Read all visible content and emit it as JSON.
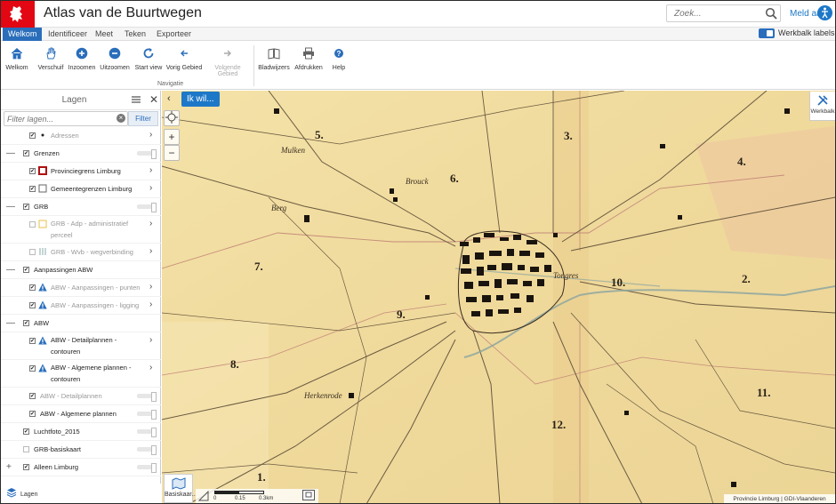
{
  "app": {
    "title": "Atlas van de Buurtwegen"
  },
  "header": {
    "search_placeholder": "Zoek...",
    "login_label": "Meld aan"
  },
  "tabs": [
    {
      "label": "Welkom",
      "active": true
    },
    {
      "label": "Identificeer"
    },
    {
      "label": "Meet"
    },
    {
      "label": "Teken"
    },
    {
      "label": "Exporteer"
    }
  ],
  "werkbalk_labels": "Werkbalk labels",
  "toolbar": {
    "tools": [
      {
        "label": "Welkom",
        "icon": "home-icon"
      },
      {
        "label": "Verschuif",
        "icon": "hand-icon"
      },
      {
        "label": "Inzoomen",
        "icon": "zoom-in-icon"
      },
      {
        "label": "Uitzoomen",
        "icon": "zoom-out-icon"
      },
      {
        "label": "Start view",
        "icon": "refresh-icon"
      },
      {
        "label": "Vorig Gebied",
        "icon": "arrow-left-icon"
      },
      {
        "label": "Volgende Gebied",
        "icon": "arrow-right-icon",
        "disabled": true
      },
      {
        "label": "Bladwijzers",
        "icon": "bookmark-icon"
      },
      {
        "label": "Afdrukken",
        "icon": "printer-icon"
      },
      {
        "label": "Help",
        "icon": "help-icon"
      }
    ],
    "group_label": "Navigatie"
  },
  "panel": {
    "title": "Lagen",
    "filter_placeholder": "Filter lagen...",
    "filter_button": "Filter",
    "footer_label": "Lagen",
    "layers": [
      {
        "label": "Adressen",
        "checked": true,
        "dim": true,
        "legend": "dot",
        "chevron": true
      },
      {
        "label": "Grenzen",
        "checked": true,
        "group": true,
        "expander": "—",
        "slider": true
      },
      {
        "label": "Provinciegrens Limburg",
        "checked": true,
        "legend": "red-square",
        "chevron": true
      },
      {
        "label": "Gemeentegrenzen Limburg",
        "checked": true,
        "legend": "grey-square",
        "chevron": true
      },
      {
        "label": "GRB",
        "checked": true,
        "group": true,
        "expander": "—",
        "slider": true
      },
      {
        "label": "GRB - Adp - administratief perceel",
        "checked": false,
        "dim": true,
        "legend": "yellow-square",
        "chevron": true,
        "tall": true
      },
      {
        "label": "GRB - Wvb - wegverbinding",
        "checked": false,
        "dim": true,
        "legend": "road",
        "chevron": true
      },
      {
        "label": "Aanpassingen ABW",
        "checked": true,
        "group": true,
        "expander": "—"
      },
      {
        "label": "ABW - Aanpassingen - punten",
        "checked": true,
        "dim": true,
        "legend": "warning",
        "chevron": true
      },
      {
        "label": "ABW - Aanpassingen - ligging",
        "checked": true,
        "dim": true,
        "legend": "warning",
        "chevron": true
      },
      {
        "label": "ABW",
        "checked": true,
        "group": true,
        "expander": "—"
      },
      {
        "label": "ABW - Detailplannen - contouren",
        "checked": true,
        "legend": "warning",
        "chevron": true,
        "tall": true
      },
      {
        "label": "ABW - Algemene plannen - contouren",
        "checked": true,
        "legend": "warning",
        "chevron": true,
        "tall": true
      },
      {
        "label": "ABW - Detailplannen",
        "checked": true,
        "dim": true,
        "slider": true
      },
      {
        "label": "ABW - Algemene plannen",
        "checked": true,
        "slider": true
      },
      {
        "label": "Luchtfoto_2015",
        "checked": true,
        "group": true,
        "slider": true
      },
      {
        "label": "GRB-basiskaart",
        "checked": false,
        "group": true,
        "slider": true
      },
      {
        "label": "Alleen Limburg",
        "checked": true,
        "group": true,
        "expander": "+",
        "slider": true
      }
    ]
  },
  "map": {
    "ikwil_label": "Ik wil...",
    "werkbalk_label": "Werkbalk",
    "basiskaart_label": "Basiskaar...",
    "scale_ticks": [
      "0",
      "0.15",
      "0.3km"
    ],
    "attribution": "Provincie Limburg | GDI-Vlaanderen",
    "section_numbers": [
      "5.",
      "3.",
      "6.",
      "4.",
      "7.",
      "2.",
      "10.",
      "9.",
      "8.",
      "11.",
      "12.",
      "1."
    ],
    "place_names": [
      "Mulken",
      "Berg",
      "Tongres",
      "Herkenrode",
      "Brouck"
    ]
  },
  "colors": {
    "brand_red": "#e30613",
    "accent_blue": "#2a6ebb",
    "map_paper": "#f0dba0"
  }
}
